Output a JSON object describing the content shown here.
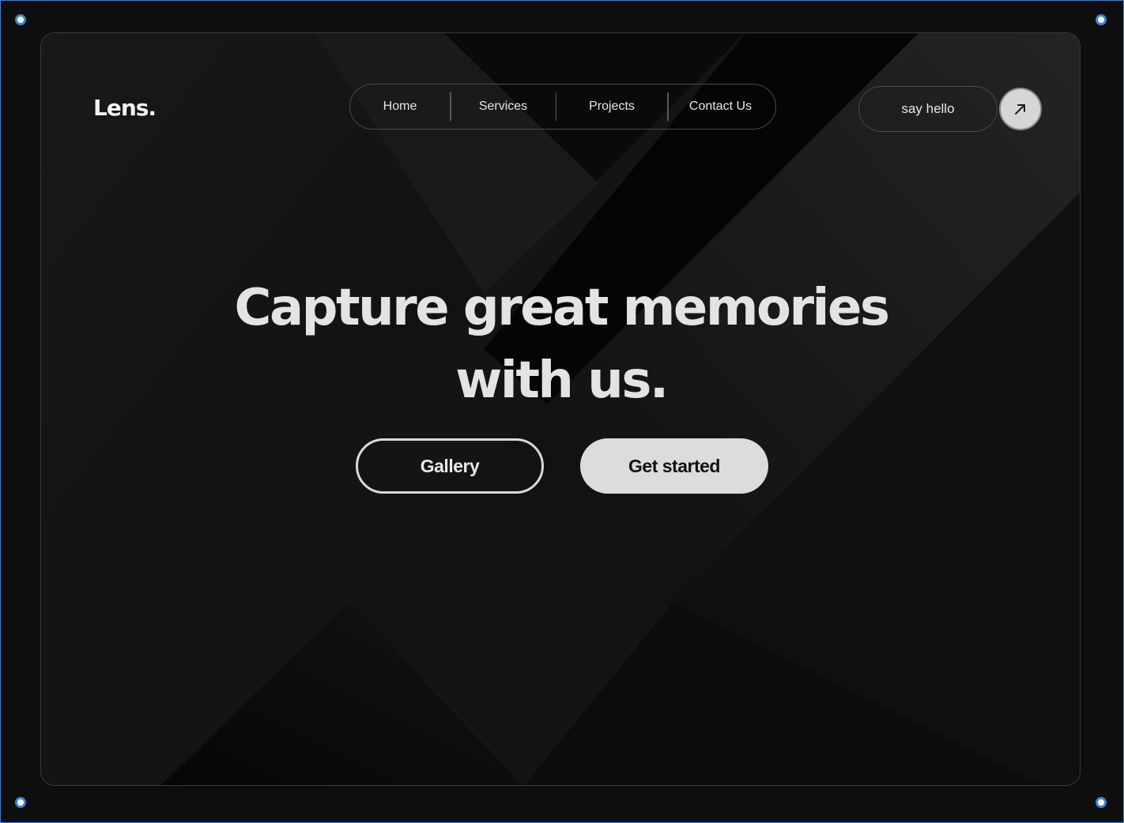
{
  "brand": {
    "logo": "Lens."
  },
  "nav": {
    "items": [
      {
        "label": "Home"
      },
      {
        "label": "Services"
      },
      {
        "label": "Projects"
      },
      {
        "label": "Contact Us"
      }
    ]
  },
  "header": {
    "say_hello_label": "say hello",
    "arrow_icon": "arrow-up-right-icon"
  },
  "hero": {
    "headline_line1": "Capture great memories",
    "headline_line2": "with us.",
    "gallery_label": "Gallery",
    "get_started_label": "Get started"
  },
  "colors": {
    "background": "#151516",
    "text": "#e3e3e3",
    "primary_button": "#dcdcdc",
    "selection_outline": "#3b82d6"
  }
}
